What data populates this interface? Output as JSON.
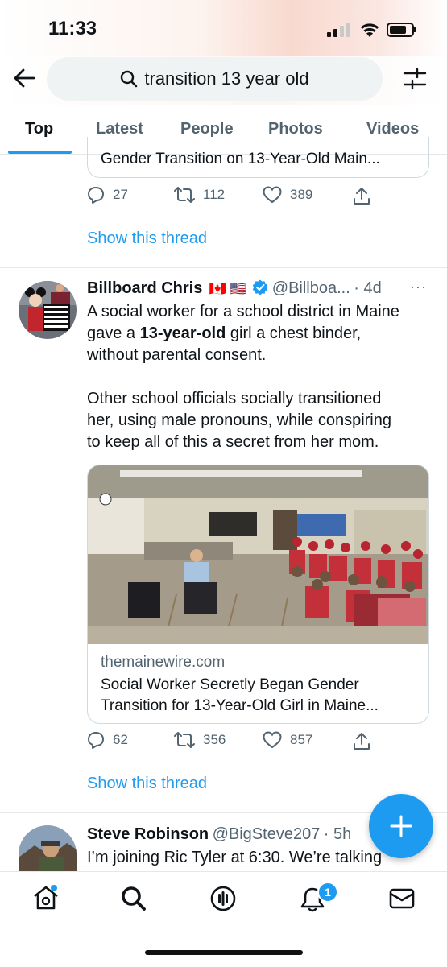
{
  "status_bar": {
    "time": "11:33"
  },
  "search": {
    "query": "transition 13 year old"
  },
  "tabs": [
    {
      "label": "Top"
    },
    {
      "label": "Latest"
    },
    {
      "label": "People"
    },
    {
      "label": "Photos"
    },
    {
      "label": "Videos"
    }
  ],
  "tweet1": {
    "card_title_tail": "Gender Transition on 13-Year-Old Main...",
    "replies": "27",
    "retweets": "112",
    "likes": "389",
    "show_thread": "Show this thread"
  },
  "tweet2": {
    "author": "Billboard Chris",
    "flags": "🇨🇦 🇺🇸",
    "handle": "@Billboa...",
    "time": "· 4d",
    "more": "···",
    "text_line1": "A social worker for a school district in Maine",
    "text_line2_pre": "gave a ",
    "text_line2_bold": "13-year-old",
    "text_line2_post": " girl a chest binder,",
    "text_line3": "without parental consent.",
    "text_line4": "Other school officials socially transitioned",
    "text_line5": "her, using male pronouns, while conspiring",
    "text_line6": "to keep all of this a secret from her mom.",
    "card_domain": "themainewire.com",
    "card_title_line1": "Social Worker Secretly Began Gender",
    "card_title_line2": "Transition for 13-Year-Old Girl in Maine...",
    "replies": "62",
    "retweets": "356",
    "likes": "857",
    "show_thread": "Show this thread",
    "avatar_sign": "CHILDREN CANNOT CONSENT TO PUBERTY BLOCKERS"
  },
  "tweet3": {
    "author": "Steve Robinson",
    "handle": "@BigSteve207",
    "time": "· 5h",
    "text_line1": "I’m joining Ric Tyler at 6:30. We’re talking"
  },
  "bottom_nav": {
    "notification_count": "1"
  },
  "colors": {
    "accent": "#1d9bf0",
    "text": "#0f1419",
    "secondary": "#536471",
    "search_bg": "#eff3f4"
  }
}
